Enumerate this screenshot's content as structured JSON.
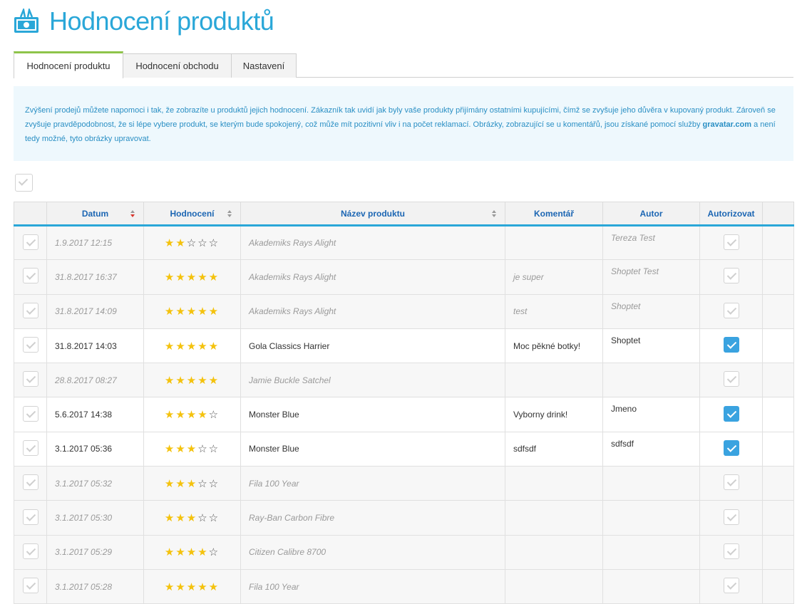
{
  "page": {
    "title": "Hodnocení produktů",
    "logo_icon": "reviews-logo-icon"
  },
  "tabs": [
    {
      "label": "Hodnocení produktu",
      "active": true
    },
    {
      "label": "Hodnocení obchodu",
      "active": false
    },
    {
      "label": "Nastavení",
      "active": false
    }
  ],
  "info": {
    "text1": "Zvýšení prodejů můžete napomoci i tak, že zobrazíte u produktů jejich hodnocení. Zákazník tak uvidí jak byly vaše produkty přijímány ostatními kupujícími, čímž se zvyšuje jeho důvěra v kupovaný produkt. Zároveň se zvyšuje pravděpodobnost, že si lépe vybere produkt, se kterým bude spokojený, což může mít pozitivní vliv i na počet reklamací. Obrázky, zobrazující se u komentářů, jsou získané pomocí služby",
    "link": "gravatar.com",
    "text2": "a není tedy možné, tyto obrázky upravovat."
  },
  "table": {
    "headers": {
      "date": "Datum",
      "rating": "Hodnocení",
      "product": "Název produktu",
      "comment": "Komentář",
      "author": "Autor",
      "authorize": "Autorizovat"
    },
    "rows": [
      {
        "date": "1.9.2017 12:15",
        "rating": 2,
        "product": "Akademiks Rays Alight",
        "comment": "",
        "author": "Tereza Test",
        "authorized": false
      },
      {
        "date": "31.8.2017 16:37",
        "rating": 5,
        "product": "Akademiks Rays Alight",
        "comment": "je super",
        "author": "Shoptet Test",
        "authorized": false
      },
      {
        "date": "31.8.2017 14:09",
        "rating": 5,
        "product": "Akademiks Rays Alight",
        "comment": "test",
        "author": "Shoptet",
        "authorized": false
      },
      {
        "date": "31.8.2017 14:03",
        "rating": 5,
        "product": "Gola Classics Harrier",
        "comment": "Moc pěkné botky!",
        "author": "Shoptet",
        "authorized": true
      },
      {
        "date": "28.8.2017 08:27",
        "rating": 5,
        "product": "Jamie Buckle Satchel",
        "comment": "",
        "author": "",
        "authorized": false
      },
      {
        "date": "5.6.2017 14:38",
        "rating": 4,
        "product": "Monster Blue",
        "comment": "Vyborny drink!",
        "author": "Jmeno",
        "authorized": true
      },
      {
        "date": "3.1.2017 05:36",
        "rating": 3,
        "product": "Monster Blue",
        "comment": "sdfsdf",
        "author": "sdfsdf",
        "authorized": true
      },
      {
        "date": "3.1.2017 05:32",
        "rating": 3,
        "product": "Fila 100 Year",
        "comment": "",
        "author": "",
        "authorized": false
      },
      {
        "date": "3.1.2017 05:30",
        "rating": 3,
        "product": "Ray-Ban Carbon Fibre",
        "comment": "",
        "author": "",
        "authorized": false
      },
      {
        "date": "3.1.2017 05:29",
        "rating": 4,
        "product": "Citizen Calibre 8700",
        "comment": "",
        "author": "",
        "authorized": false
      },
      {
        "date": "3.1.2017 05:28",
        "rating": 5,
        "product": "Fila 100 Year",
        "comment": "",
        "author": "",
        "authorized": false
      }
    ]
  },
  "colors": {
    "accent": "#2aa7d8",
    "tab_active": "#8ec44a",
    "star": "#f4c20d",
    "checkbox_on": "#3aa3e0"
  }
}
